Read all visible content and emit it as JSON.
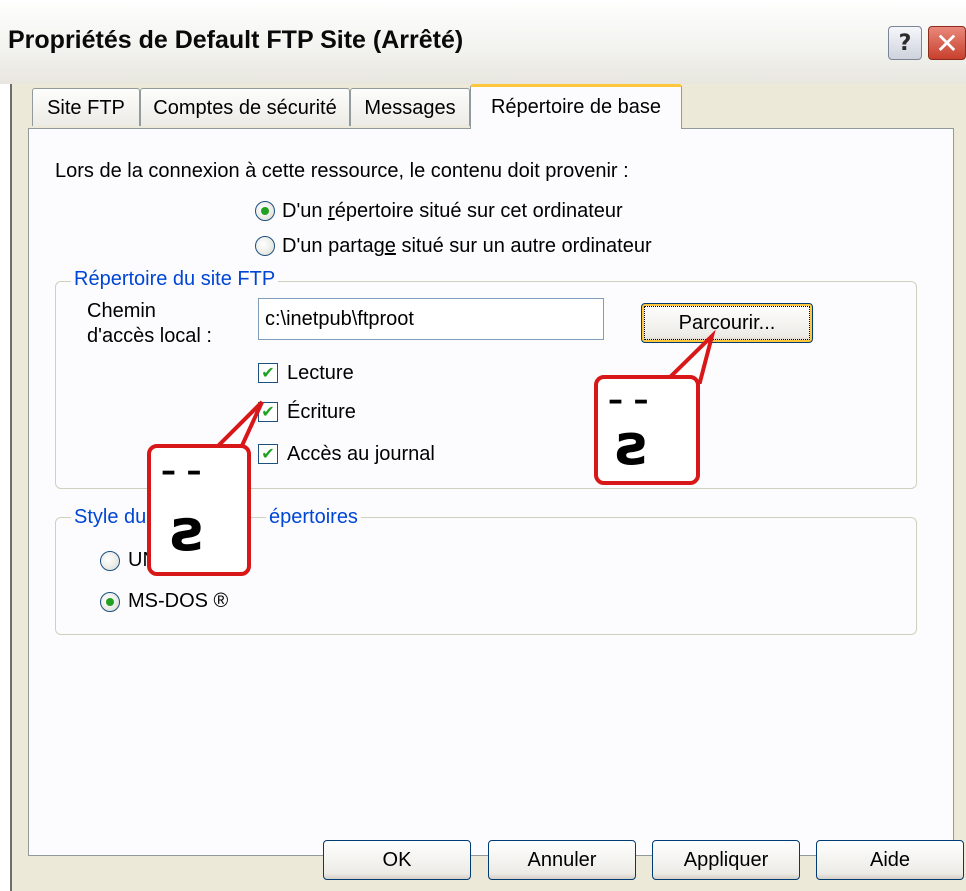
{
  "window": {
    "title": "Propriétés de Default FTP Site (Arrêté)",
    "help_glyph": "?",
    "close_glyph": "✕"
  },
  "tabs": [
    {
      "label": "Site FTP"
    },
    {
      "label": "Comptes de sécurité"
    },
    {
      "label": "Messages"
    },
    {
      "label": "Répertoire de base"
    }
  ],
  "content": {
    "intro": "Lors de la connexion à cette ressource, le contenu doit provenir :",
    "source_options": [
      {
        "label_pre": "D'un ",
        "label_u": "r",
        "label_post": "épertoire situé sur cet ordinateur",
        "selected": true
      },
      {
        "label_pre": "D'un partag",
        "label_u": "e",
        "label_post": " situé sur un autre ordinateur",
        "selected": false
      }
    ]
  },
  "ftp_group": {
    "legend": "Répertoire du site FTP",
    "path_label_line1": "Chemin",
    "path_label_line2": "d'accès local :",
    "path_value": "c:\\inetpub\\ftproot",
    "browse_label": "Parcourir...",
    "permissions": [
      {
        "label": "Lecture",
        "checked": true
      },
      {
        "label": "Écriture",
        "checked": true
      },
      {
        "label": "Accès au journal",
        "checked": true
      }
    ],
    "check_glyph": "✔"
  },
  "listing_group": {
    "legend_left": "Style du",
    "legend_right": "épertoires",
    "options": [
      {
        "label_u": "",
        "label": "UNIX ®",
        "selected": false
      },
      {
        "label": "MS-DOS ®",
        "selected": true
      }
    ]
  },
  "footer": {
    "ok": "OK",
    "cancel": "Annuler",
    "apply": "Appliquer",
    "help": "Aide"
  },
  "stickers": {
    "eyes": "–  –",
    "mouth": "ƨ"
  },
  "colors": {
    "accent": "#ffc83c",
    "legend_blue": "#0046d5",
    "callout_red": "#d81818",
    "radio_green": "#21a121"
  }
}
